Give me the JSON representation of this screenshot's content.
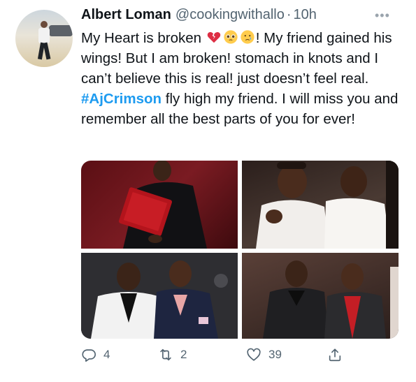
{
  "tweet": {
    "author_name": "Albert Loman",
    "handle": "@cookingwithallo",
    "separator": "·",
    "time": "10h",
    "more_label": "•••",
    "text_part1": "My Heart is broken",
    "emoji": [
      "broken-heart-emoji",
      "pleading-face-emoji",
      "crying-face-emoji"
    ],
    "text_part2": "! My friend gained his wings! But I am broken! stomach in knots and I can’t believe this is real! just doesn’t feel real.",
    "hashtag": "#AjCrimson",
    "text_part3": "fly high my friend. I will miss you and remember all the best parts of you for ever!"
  },
  "media": {
    "photos": [
      "man-in-black-with-red-box-photo",
      "two-men-in-white-shirts-photo",
      "two-men-in-suits-photo",
      "two-men-at-party-photo"
    ]
  },
  "actions": {
    "reply_count": "4",
    "retweet_count": "2",
    "like_count": "39",
    "icons": [
      "reply-icon",
      "retweet-icon",
      "like-icon",
      "share-icon"
    ]
  },
  "colors": {
    "text": "#0f1419",
    "secondary": "#536471",
    "link": "#1d9bf0",
    "background": "#ffffff"
  }
}
